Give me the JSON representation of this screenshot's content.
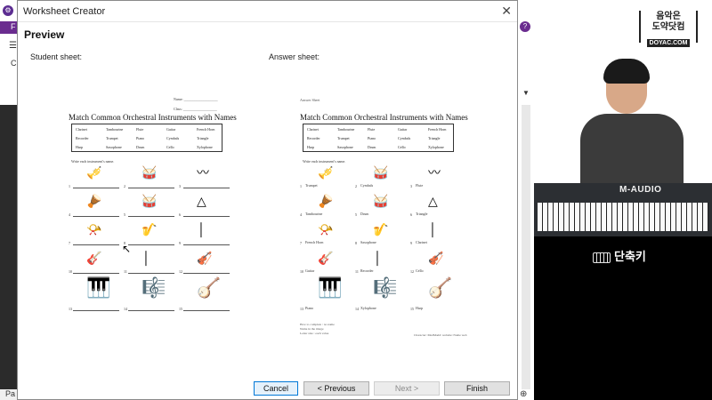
{
  "background_app": {
    "ribbon_tab": "F",
    "tool_label": "C",
    "status_text": "Pa"
  },
  "dialog": {
    "title": "Worksheet Creator",
    "heading": "Preview",
    "student_label": "Student sheet:",
    "answer_label": "Answer sheet:",
    "buttons": {
      "cancel": "Cancel",
      "previous": "< Previous",
      "next": "Next >",
      "finish": "Finish"
    }
  },
  "worksheet": {
    "title": "Match Common Orchestral Instruments with Names",
    "name_label": "Name: ___________________",
    "class_label": "Class: ___________________",
    "answer_tag": "Answer Sheet",
    "instructions": "Write each instrument's name.",
    "word_bank": [
      [
        "Clarinet",
        "Tambourine",
        "Flute",
        "Guitar",
        "French Horn"
      ],
      [
        "Recorder",
        "Trumpet",
        "Piano",
        "Cymbals",
        "Triangle"
      ],
      [
        "Harp",
        "Saxophone",
        "Drum",
        "Cello",
        "Xylophone"
      ]
    ],
    "items": [
      {
        "num": "1",
        "icon": "🎺",
        "answer": "Trumpet"
      },
      {
        "num": "2",
        "icon": "🥁",
        "answer": "Cymbals"
      },
      {
        "num": "3",
        "icon": "〰",
        "answer": "Flute"
      },
      {
        "num": "4",
        "icon": "🪘",
        "answer": "Tambourine"
      },
      {
        "num": "5",
        "icon": "🥁",
        "answer": "Drum"
      },
      {
        "num": "6",
        "icon": "△",
        "answer": "Triangle"
      },
      {
        "num": "7",
        "icon": "📯",
        "answer": "French Horn"
      },
      {
        "num": "8",
        "icon": "🎷",
        "answer": "Saxophone"
      },
      {
        "num": "9",
        "icon": "│",
        "answer": "Clarinet"
      },
      {
        "num": "10",
        "icon": "🎸",
        "answer": "Guitar"
      },
      {
        "num": "11",
        "icon": "│",
        "answer": "Recorder"
      },
      {
        "num": "12",
        "icon": "🎻",
        "answer": "Cello"
      },
      {
        "num": "13",
        "icon": "🎹",
        "answer": "Piano"
      },
      {
        "num": "14",
        "icon": "🎼",
        "answer": "Xylophone"
      },
      {
        "num": "15",
        "icon": "🪕",
        "answer": "Harp"
      }
    ],
    "footnote": "How to complete : no name\nName in the image\nLetter size : each value",
    "footnote_right": "Character: MadMadd: website: Name web"
  },
  "webcam": {
    "logo_line1": "음악은",
    "logo_line2": "도약닷컴",
    "logo_en": "DOYAC.COM",
    "keyboard_brand": "M-AUDIO",
    "shortcut_label": "단축키"
  }
}
